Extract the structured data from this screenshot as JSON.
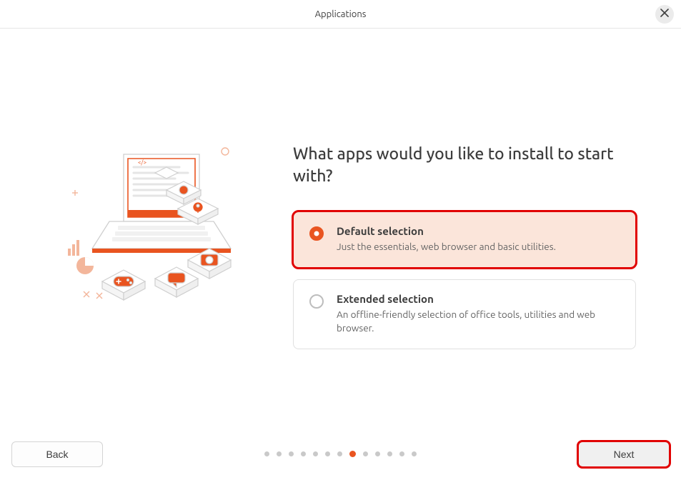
{
  "header": {
    "title": "Applications"
  },
  "heading": "What apps would you like to install to start with?",
  "options": [
    {
      "title": "Default selection",
      "desc": "Just the essentials, web browser and basic utilities.",
      "selected": true,
      "highlighted": true
    },
    {
      "title": "Extended selection",
      "desc": "An offline-friendly selection of office tools, utilities and web browser.",
      "selected": false,
      "highlighted": false
    }
  ],
  "pager": {
    "total": 13,
    "active_index": 7
  },
  "buttons": {
    "back": "Back",
    "next": "Next"
  },
  "next_highlighted": true,
  "colors": {
    "accent": "#e95420",
    "highlight": "#e10000",
    "card_selected_bg": "#fbe5da"
  }
}
